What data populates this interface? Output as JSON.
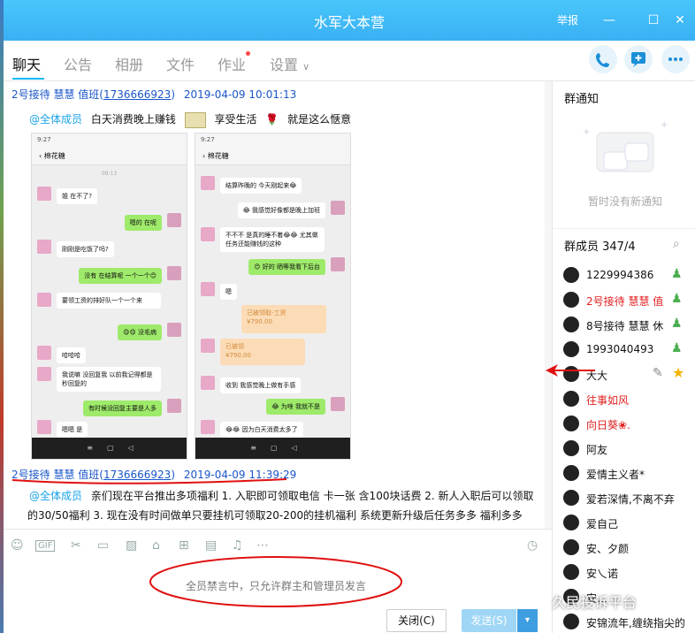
{
  "window": {
    "title": "水军大本营",
    "report": "举报",
    "minimize": "—",
    "maximize": "☐",
    "close": "✕"
  },
  "tabs": [
    "聊天",
    "公告",
    "相册",
    "文件",
    "作业",
    "设置"
  ],
  "tab_settings_caret": "∨",
  "messages": [
    {
      "sender": "2号接待 慧慧 值班(",
      "sender_id": "1736666923",
      "sender_close": ")",
      "time": "2019-04-09 10:01:13",
      "at": "@全体成员",
      "text1": "白天消费晚上赚钱",
      "text2": "享受生活",
      "text3": "就是这么惬意"
    },
    {
      "sender": "2号接待 慧慧 值班(",
      "sender_id": "1736666923",
      "sender_close": ")",
      "time": "2019-04-09 11:39:29",
      "at": "@全体成员",
      "line1": "亲们现在平台推出多项福利   1. 入职即可领取电信 卡一张 含100块话费   2. 新人入职后可以领取",
      "line2": "的30/50福利   3. 现在没有时间做单只要挂机可领取20-200的挂机福利    系统更新升级后任务多多  福利多多"
    }
  ],
  "phone1": {
    "status": "9:27",
    "contact": "棉花糖",
    "time": "09:13",
    "bubbles": [
      "姐 在不了?",
      "嗯的 在呢",
      "刚刚是吃饭了吗?",
      "没有 在结算呢  一个一个😊",
      "要领工资的排好队一个一个来",
      "😋😋 没毛病",
      "哈哈哈",
      "我说嘛 没回复我 以前我记得都是秒回复的",
      "有时候没回复主要是人多",
      "嗯嗯 是"
    ]
  },
  "phone2": {
    "status": "9:27",
    "contact": "棉花糖",
    "bubbles": [
      "结算昨晚的  今天刚起来😂",
      "😂 我感觉好像都是晚上加班",
      "不不不  是真的睡不着😂😂 尤其做任务还能赚钱的这种",
      "😊 好的  晒等我看下后台",
      "嗯",
      "已被领取-工资\n¥790.00",
      "已被领\n¥790.00",
      "收到 我感觉晚上做有手感",
      "😂 为啥  我就不是",
      "😂😂 因为白天消费太多了"
    ]
  },
  "toolbar_icons": [
    "smile-icon",
    "gif-icon",
    "scissors-icon",
    "folder-icon",
    "image-icon",
    "gift-icon",
    "present-icon",
    "calendar-icon",
    "bell-icon",
    "more-icon",
    "history-icon"
  ],
  "input": {
    "muted_text": "全员禁言中，只允许群主和管理员发言"
  },
  "buttons": {
    "close": "关闭(C)",
    "send": "发送(S)",
    "send_arrow": "▾"
  },
  "right_panel": {
    "notice_title": "群通知",
    "notice_empty": "暂时没有新通知",
    "members_title": "群成员 347/4",
    "members": [
      {
        "name": "1229994386",
        "red": false
      },
      {
        "name": "2号接待 慧慧 值",
        "red": true
      },
      {
        "name": "8号接待 慧慧 休",
        "red": false
      },
      {
        "name": "1993040493",
        "red": false
      },
      {
        "name": "大大",
        "red": false
      },
      {
        "name": "往事如风",
        "red": true
      },
      {
        "name": "向日葵❀.",
        "red": true
      },
      {
        "name": "阿友",
        "red": false
      },
      {
        "name": "爱情主义者*",
        "red": false
      },
      {
        "name": "爱若深情,不离不弃",
        "red": false
      },
      {
        "name": "爱自己",
        "red": false
      },
      {
        "name": "安、夕颜",
        "red": false
      },
      {
        "name": "安乀诺",
        "red": false
      },
      {
        "name": "安…",
        "red": false
      },
      {
        "name": "安锦流年,缠绕指尖的",
        "red": false
      }
    ]
  },
  "watermark": "久民投诉平台"
}
